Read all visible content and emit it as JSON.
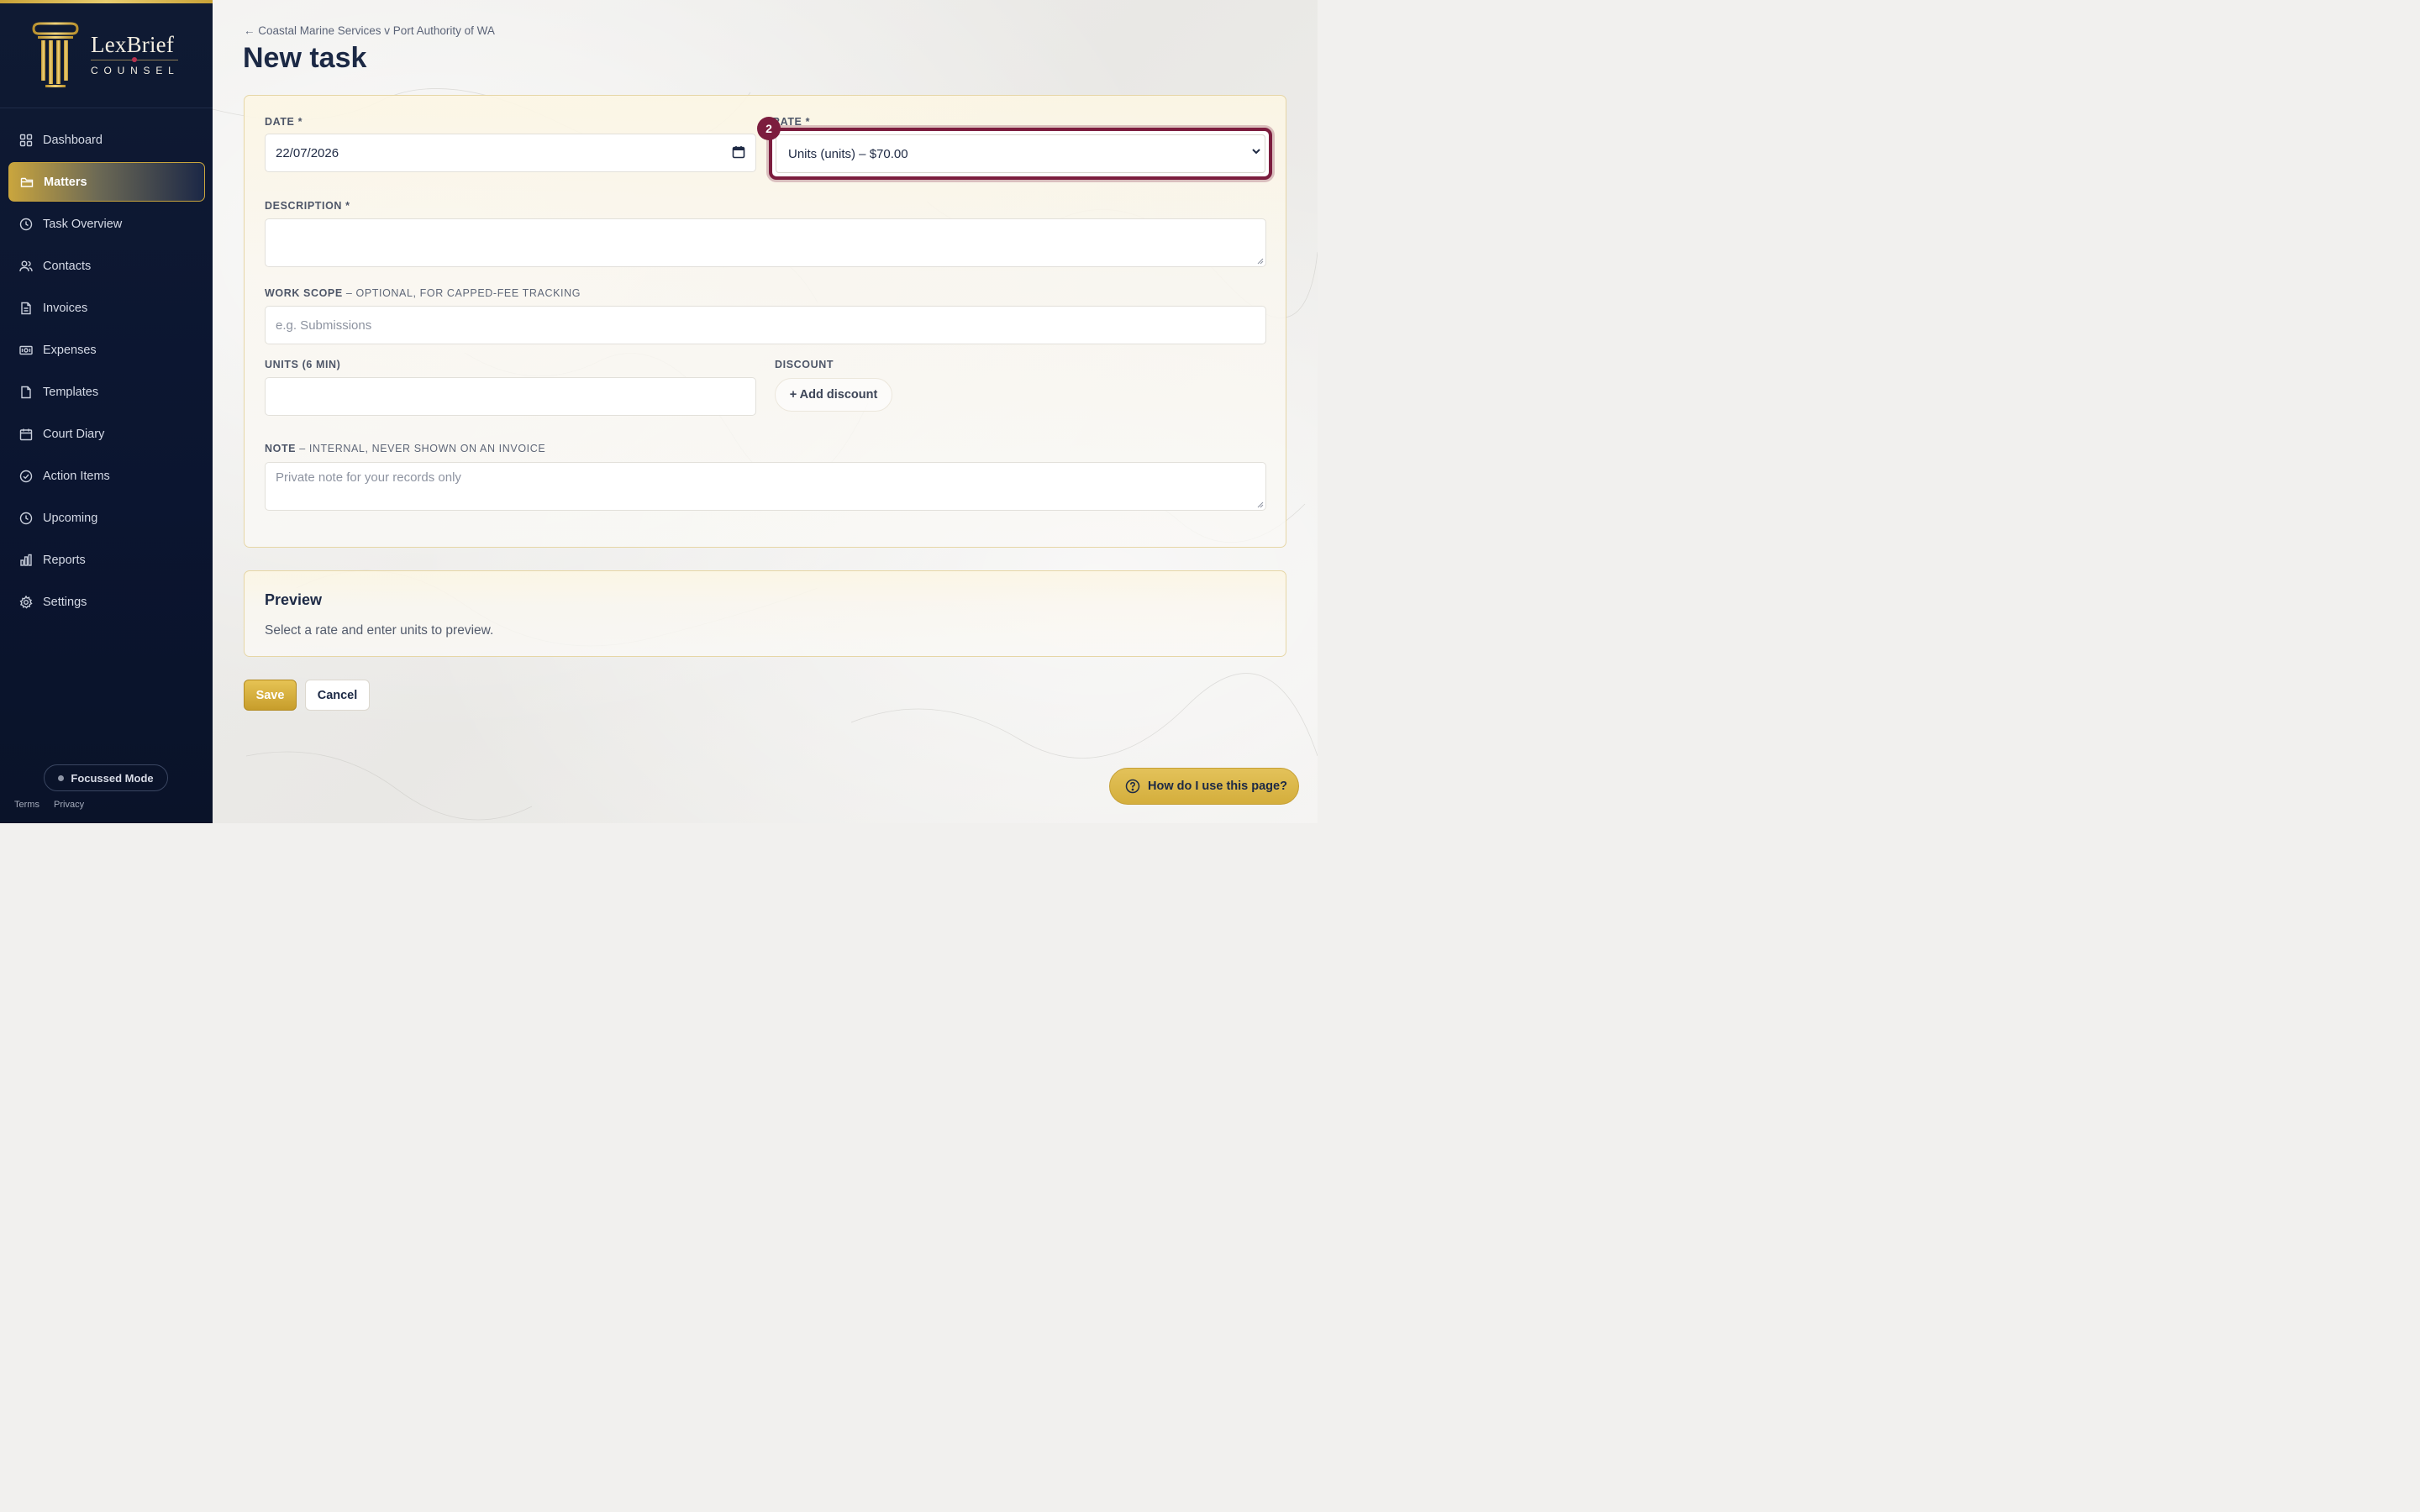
{
  "brand": {
    "name": "LexBrief",
    "sub": "COUNSEL"
  },
  "nav": [
    {
      "label": "Dashboard",
      "icon": "grid-icon",
      "active": false
    },
    {
      "label": "Matters",
      "icon": "folder-icon",
      "active": true
    },
    {
      "label": "Task Overview",
      "icon": "clock-icon",
      "active": false
    },
    {
      "label": "Contacts",
      "icon": "users-icon",
      "active": false
    },
    {
      "label": "Invoices",
      "icon": "file-text-icon",
      "active": false
    },
    {
      "label": "Expenses",
      "icon": "banknote-icon",
      "active": false
    },
    {
      "label": "Templates",
      "icon": "file-icon",
      "active": false
    },
    {
      "label": "Court Diary",
      "icon": "calendar-icon",
      "active": false
    },
    {
      "label": "Action Items",
      "icon": "check-circle-icon",
      "active": false
    },
    {
      "label": "Upcoming",
      "icon": "clock-icon",
      "active": false
    },
    {
      "label": "Reports",
      "icon": "bar-chart-icon",
      "active": false
    },
    {
      "label": "Settings",
      "icon": "gear-icon",
      "active": false
    }
  ],
  "sidebar": {
    "focus_mode": "Focussed Mode",
    "terms": "Terms",
    "privacy": "Privacy"
  },
  "page": {
    "breadcrumb": "← Coastal Marine Services v Port Authority of WA",
    "title": "New task"
  },
  "form": {
    "date": {
      "label": "DATE *",
      "value": "22/07/2026"
    },
    "rate": {
      "label": "RATE *",
      "value": "Units (units) – $70.00",
      "badge": "2"
    },
    "description": {
      "label": "DESCRIPTION *",
      "value": ""
    },
    "work_scope": {
      "label": "WORK SCOPE",
      "hint": " – OPTIONAL, FOR CAPPED-FEE TRACKING",
      "placeholder": "e.g. Submissions"
    },
    "units": {
      "label": "UNITS (6 MIN)",
      "value": ""
    },
    "discount": {
      "label": "DISCOUNT",
      "button": "+ Add discount"
    },
    "note": {
      "label": "NOTE",
      "hint": " – INTERNAL, NEVER SHOWN ON AN INVOICE",
      "placeholder": "Private note for your records only"
    }
  },
  "preview": {
    "title": "Preview",
    "text": "Select a rate and enter units to preview."
  },
  "actions": {
    "save": "Save",
    "cancel": "Cancel"
  },
  "help": {
    "label": "How do I use this page?"
  },
  "colors": {
    "accent_gold": "#c9a53e",
    "accent_maroon": "#7c1d3e",
    "sidebar_bg": "#0f1a33"
  }
}
